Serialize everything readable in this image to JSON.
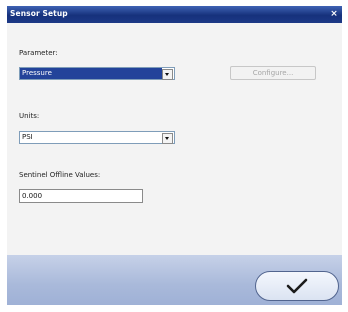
{
  "window": {
    "title": "Sensor Setup",
    "close_glyph": "×"
  },
  "form": {
    "parameter_label": "Parameter:",
    "parameter_value": "Pressure",
    "units_label": "Units:",
    "units_value": "PSI",
    "offline_label": "Sentinel Offline Values:",
    "offline_value": "0.000"
  },
  "buttons": {
    "configure_label": "Configure...",
    "ok_icon": "check-icon"
  }
}
